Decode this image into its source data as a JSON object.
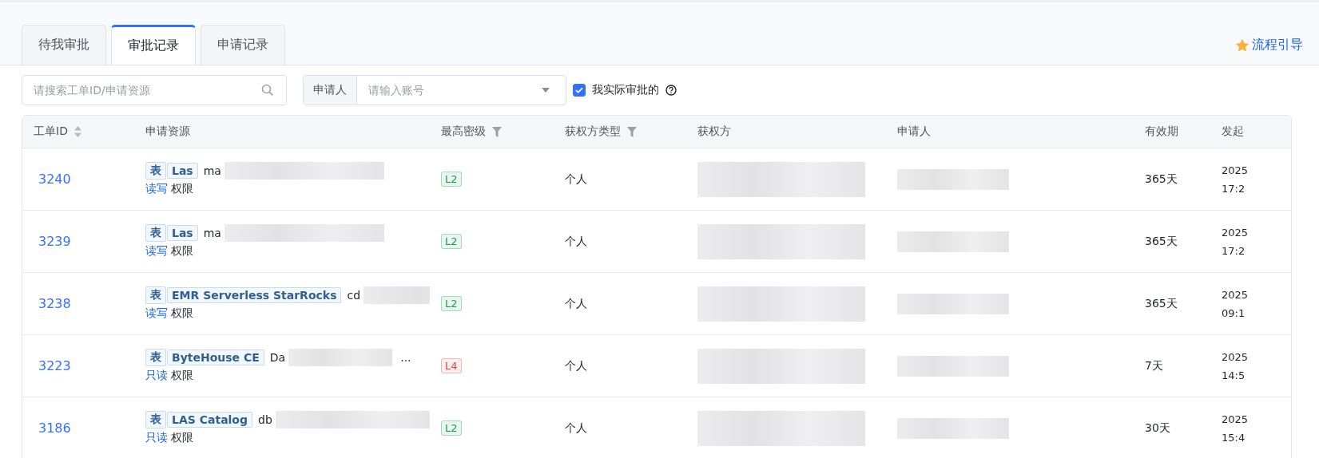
{
  "tabs": [
    {
      "label": "待我审批",
      "selected": false
    },
    {
      "label": "审批记录",
      "selected": true
    },
    {
      "label": "申请记录",
      "selected": false
    }
  ],
  "guide_link": "流程引导",
  "filters": {
    "search": {
      "placeholder": "请搜索工单ID/申请资源"
    },
    "applicant": {
      "label": "申请人",
      "placeholder": "请输入账号"
    },
    "actual_approved": {
      "label": "我实际审批的",
      "checked": true
    }
  },
  "table": {
    "columns": [
      {
        "label": "工单ID",
        "kind": "sortable"
      },
      {
        "label": "申请资源",
        "kind": "plain"
      },
      {
        "label": "最高密级",
        "kind": "filterable"
      },
      {
        "label": "获权方类型",
        "kind": "filterable"
      },
      {
        "label": "获权方",
        "kind": "plain"
      },
      {
        "label": "申请人",
        "kind": "plain"
      },
      {
        "label": "有效期",
        "kind": "plain"
      },
      {
        "label": "发起",
        "kind": "plain"
      }
    ],
    "rows": [
      {
        "id": "3240",
        "resource_type": "表",
        "engine": "Las",
        "resource_name": "ma",
        "access": "读写",
        "access_suffix": "权限",
        "level": "L2",
        "color": "#1a9f50",
        "grantee_type": "个人",
        "validity": "365天",
        "start_date": "2025",
        "start_time": "17:2"
      },
      {
        "id": "3239",
        "resource_type": "表",
        "engine": "Las",
        "resource_name": "ma",
        "access": "读写",
        "access_suffix": "权限",
        "level": "L2",
        "color": "#1a9f50",
        "grantee_type": "个人",
        "validity": "365天",
        "start_date": "2025",
        "start_time": "17:2"
      },
      {
        "id": "3238",
        "resource_type": "表",
        "engine": "EMR Serverless StarRocks",
        "resource_name": "cd",
        "access": "读写",
        "access_suffix": "权限",
        "level": "L2",
        "color": "#1a9f50",
        "grantee_type": "个人",
        "validity": "365天",
        "start_date": "2025",
        "start_time": "09:1"
      },
      {
        "id": "3223",
        "resource_type": "表",
        "engine": "ByteHouse CE",
        "resource_name": "Da",
        "resource_tail": "...",
        "access": "只读",
        "access_suffix": "权限",
        "level": "L4",
        "color": "#e0463e",
        "grantee_type": "个人",
        "validity": "7天",
        "start_date": "2025",
        "start_time": "14:5"
      },
      {
        "id": "3186",
        "resource_type": "表",
        "engine": "LAS Catalog",
        "resource_name": "db",
        "access": "只读",
        "access_suffix": "权限",
        "level": "L2",
        "color": "#1a9f50",
        "grantee_type": "个人",
        "validity": "30天",
        "start_date": "2025",
        "start_time": "15:4"
      }
    ]
  }
}
